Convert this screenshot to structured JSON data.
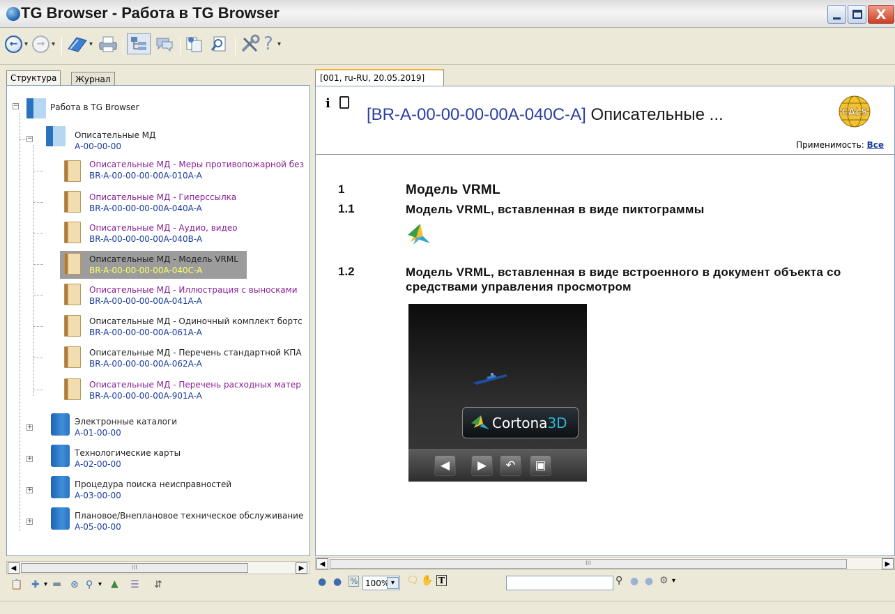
{
  "window": {
    "title": "TG Browser - Работа в TG Browser",
    "close_glyph": "X"
  },
  "toolbar": {
    "icons": [
      "back-icon",
      "forward-icon",
      "book-icon",
      "print-icon",
      "structure-icon",
      "comments-icon",
      "copy-icon",
      "search-doc-icon",
      "settings-icon",
      "help-icon"
    ]
  },
  "left": {
    "tabs": [
      "Структура",
      "Журнал"
    ],
    "tree": [
      {
        "label": "Работа в TG Browser",
        "code": "",
        "color": "black",
        "level": 0
      },
      {
        "label": "Описательные МД",
        "code": "А-00-00-00",
        "color": "black",
        "level": 1
      },
      {
        "label": "Описательные МД - Меры противопожарной без",
        "code": "BR-A-00-00-00-00A-010A-A",
        "color": "purple",
        "level": 2
      },
      {
        "label": "Описательные МД - Гиперссылка",
        "code": "BR-A-00-00-00-00A-040A-A",
        "color": "purple",
        "level": 2
      },
      {
        "label": "Описательные МД - Аудио, видео",
        "code": "BR-A-00-00-00-00A-040B-A",
        "color": "purple",
        "level": 2
      },
      {
        "label": "Описательные МД - Модель VRML",
        "code": "BR-A-00-00-00-00A-040C-A",
        "color": "black",
        "level": 2,
        "selected": true
      },
      {
        "label": "Описательные МД - Иллюстрация с выносками",
        "code": "BR-A-00-00-00-00A-041A-A",
        "color": "purple",
        "level": 2
      },
      {
        "label": "Описательные МД - Одиночный комплект бортс",
        "code": "BR-A-00-00-00-00A-061A-A",
        "color": "black",
        "level": 2
      },
      {
        "label": "Описательные МД - Перечень стандартной КПА",
        "code": "BR-A-00-00-00-00A-062A-A",
        "color": "black",
        "level": 2
      },
      {
        "label": "Описательные МД - Перечень расходных матер",
        "code": "BR-A-00-00-00-00A-901A-A",
        "color": "purple",
        "level": 2
      },
      {
        "label": "Электронные каталоги",
        "code": "A-01-00-00",
        "color": "black",
        "level": 1
      },
      {
        "label": "Технологические карты",
        "code": "A-02-00-00",
        "color": "black",
        "level": 1
      },
      {
        "label": "Процедура поиска неисправностей",
        "code": "A-03-00-00",
        "color": "black",
        "level": 1
      },
      {
        "label": "Плановое/Внеплановое техническое обслуживание",
        "code": "A-05-00-00",
        "color": "black",
        "level": 1
      }
    ],
    "scroll_grip": "III"
  },
  "right": {
    "tab": "[001, ru-RU, 20.05.2019]",
    "info_glyph": "i",
    "dm_code": "[BR-A-00-00-00-00A-040C-A]",
    "dm_title": " Описательные ...",
    "logo_text": "CALS",
    "applicability_label": "Применимость:",
    "applicability_value": "Все",
    "sections": [
      {
        "num": "1",
        "text": "Модель VRML"
      },
      {
        "num": "1.1",
        "text": "Модель VRML, вставленная в виде пиктограммы"
      },
      {
        "num": "1.2",
        "text": "Модель VRML, вставленная в виде встроенного в документ объекта со средствами управления просмотром"
      }
    ],
    "viewer": {
      "brand": "Cortona",
      "brand_suffix": "3D"
    },
    "scroll_grip": "III",
    "zoom": "100%",
    "search_value": ""
  },
  "colors": {
    "link": "#1a3c9e",
    "purple": "#8a1f95",
    "selected_bg": "#9c9c9c",
    "selected_code": "#ffff66",
    "tab_accent": "#f0b243"
  }
}
